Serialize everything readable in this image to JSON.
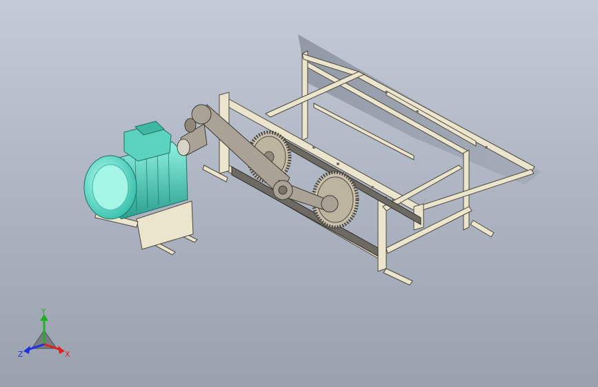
{
  "viewport": {
    "background_top": "#c4cbd6",
    "background_bottom": "#9aa1ae"
  },
  "model": {
    "frame_color": "#ece5cd",
    "frame_edge": "#4a463c",
    "motor_color": "#6fe3cf",
    "motor_dark": "#2fae9c",
    "gear_color": "#c9c1ad",
    "rack_color": "#6d6a63",
    "link_color": "#aaa294"
  },
  "triad": {
    "x_label": "X",
    "y_label": "Y",
    "z_label": "Z",
    "x_color": "#e02020",
    "y_color": "#20b020",
    "z_color": "#2030e0"
  }
}
